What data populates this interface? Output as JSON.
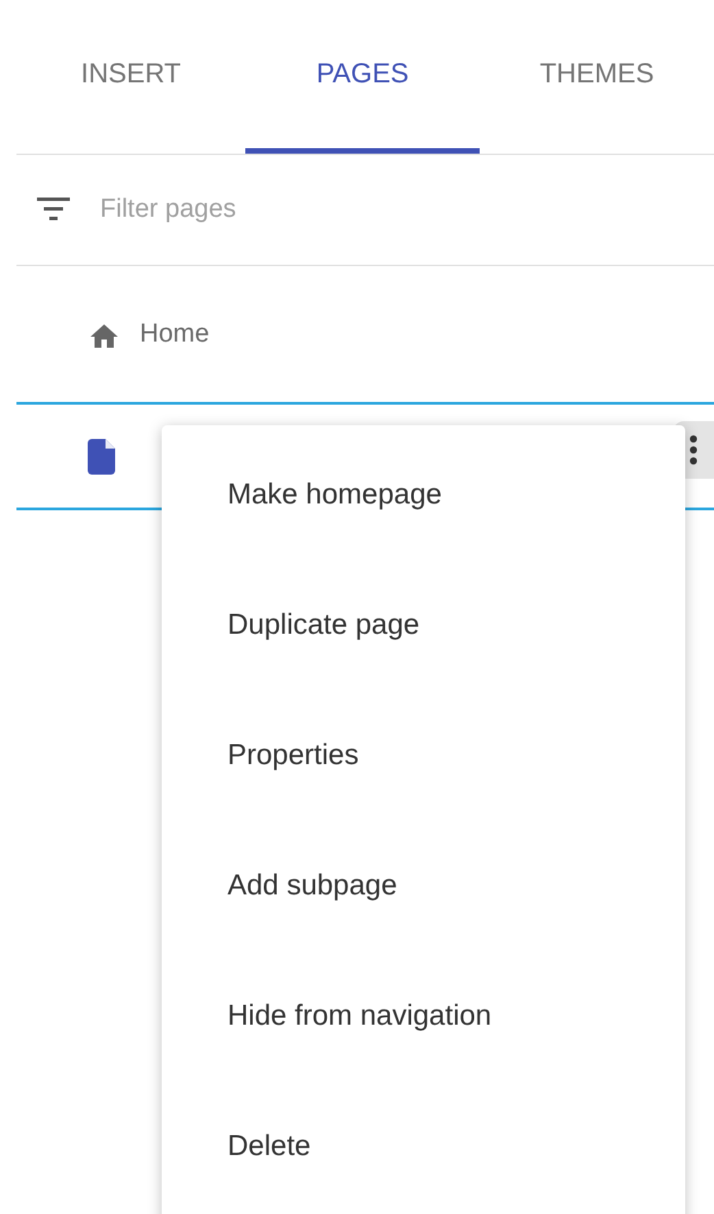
{
  "tabs": [
    {
      "label": "INSERT",
      "selected": false
    },
    {
      "label": "PAGES",
      "selected": true
    },
    {
      "label": "THEMES",
      "selected": false
    }
  ],
  "filter": {
    "placeholder": "Filter pages"
  },
  "pages": [
    {
      "kind": "home",
      "title": "Home",
      "selected": false
    },
    {
      "kind": "page",
      "selected": true
    }
  ],
  "menu": {
    "items": [
      "Make homepage",
      "Duplicate page",
      "Properties",
      "Add subpage",
      "Hide from navigation",
      "Delete"
    ]
  }
}
